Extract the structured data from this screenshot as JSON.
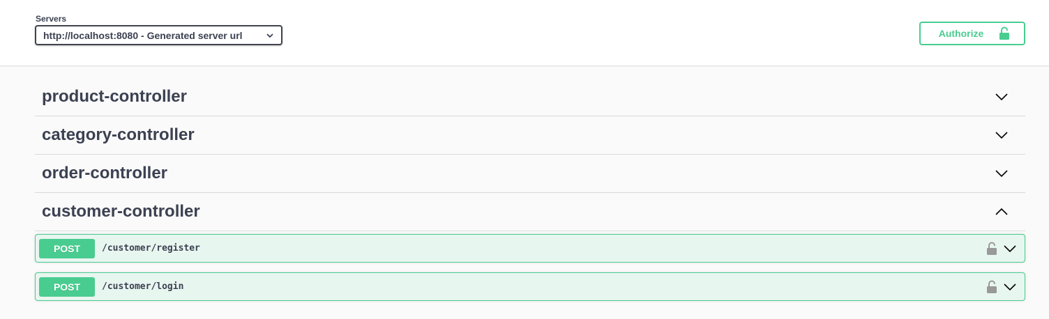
{
  "servers": {
    "label": "Servers",
    "selected": "http://localhost:8080 - Generated server url"
  },
  "authorize": {
    "label": "Authorize",
    "icon": "unlocked-lock-icon",
    "color": "#49cc90"
  },
  "tags": [
    {
      "name": "product-controller",
      "expanded": false
    },
    {
      "name": "category-controller",
      "expanded": false
    },
    {
      "name": "order-controller",
      "expanded": false
    },
    {
      "name": "customer-controller",
      "expanded": true
    }
  ],
  "operations": [
    {
      "method": "POST",
      "path": "/customer/register"
    },
    {
      "method": "POST",
      "path": "/customer/login"
    }
  ],
  "colors": {
    "post": "#49cc90",
    "post_bg": "#e8f6f0",
    "text": "#3b4151"
  }
}
